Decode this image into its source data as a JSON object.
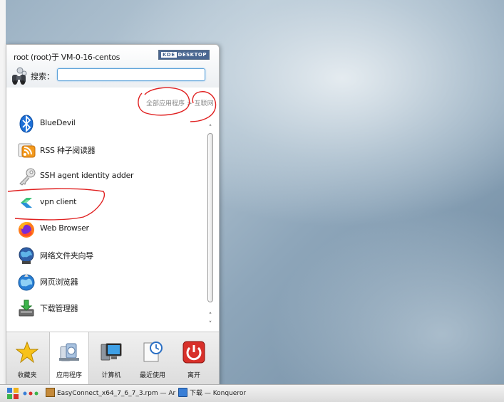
{
  "menu": {
    "user_label": "root (root)于 VM-0-16-centos",
    "logo_k": "KDE",
    "logo_text": "DESKTOP",
    "search_label": "搜索：",
    "search_value": "",
    "breadcrumb": {
      "all_apps": "全部应用程序",
      "separator": ">",
      "current": "互联网"
    },
    "apps": [
      {
        "label": "BlueDevil",
        "icon": "bluetooth-icon"
      },
      {
        "label": "RSS 种子阅读器",
        "icon": "rss-reader-icon"
      },
      {
        "label": "SSH agent identity adder",
        "icon": "key-icon"
      },
      {
        "label": "vpn client",
        "icon": "vpn-client-icon"
      },
      {
        "label": "Web Browser",
        "icon": "firefox-icon"
      },
      {
        "label": "网络文件夹向导",
        "icon": "network-folder-icon"
      },
      {
        "label": "网页浏览器",
        "icon": "konqueror-icon"
      },
      {
        "label": "下载管理器",
        "icon": "download-manager-icon"
      }
    ],
    "tabs": [
      {
        "label": "收藏夹",
        "icon": "star-icon"
      },
      {
        "label": "应用程序",
        "icon": "applications-icon"
      },
      {
        "label": "计算机",
        "icon": "computer-icon"
      },
      {
        "label": "最近使用",
        "icon": "recent-icon"
      },
      {
        "label": "离开",
        "icon": "power-icon"
      }
    ],
    "active_tab": "应用程序"
  },
  "taskbar": {
    "task1": "EasyConnect_x64_7_6_7_3.rpm — Ar",
    "task2": "下载 — Konqueror"
  },
  "colors": {
    "accent": "#5aa0d8",
    "annotation": "#e02020",
    "kde_blue": "#4a6791"
  }
}
